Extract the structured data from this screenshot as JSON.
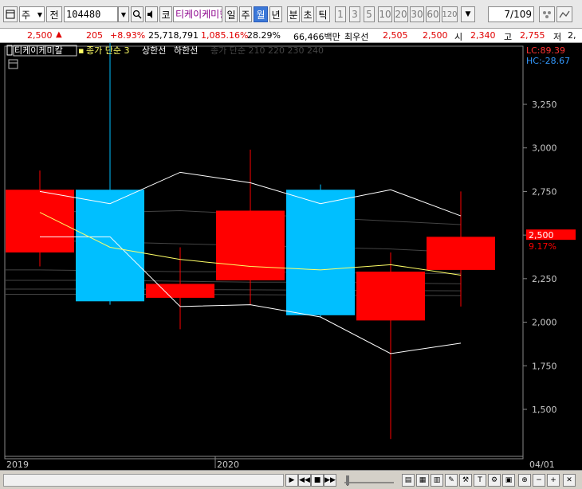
{
  "toolbar": {
    "period_type": "주",
    "prev_label": "전",
    "stock_code": "104480",
    "code_label": "코",
    "stock_name": "티케이케미칼",
    "timeframes": [
      "일",
      "주",
      "월",
      "년",
      "분",
      "초",
      "틱"
    ],
    "selected_timeframe": "월",
    "intervals": [
      "1",
      "3",
      "5",
      "10",
      "20",
      "30",
      "60",
      "120"
    ],
    "page_value": "7",
    "page_total": "/109"
  },
  "quote": {
    "price": "2,500",
    "change": "205",
    "change_pct": "+8.93%",
    "volume": "25,718,791",
    "volume_ratio": "1,085.16%",
    "turnover": "28.29%",
    "amount": "66,466백만",
    "bid_label": "최우선",
    "ask": "2,505",
    "bid": "2,500",
    "open_label": "시",
    "open": "2,340",
    "high_label": "고",
    "high": "2,755",
    "low_label": "저",
    "low": "2,"
  },
  "legend": {
    "name": "티케이케미칼",
    "ma": "종가 단순 3",
    "upper": "상한선",
    "lower": "하한선",
    "ma_grey": "종가 단순 210 220 230 240",
    "lc": "LC:89.39",
    "hc": "HC:-28.67"
  },
  "chart_data": {
    "type": "candlestick",
    "x_labels": [
      "2019",
      "2020",
      "04/01"
    ],
    "y_ticks": [
      1500,
      1750,
      2000,
      2250,
      2500,
      2750,
      3000,
      3250
    ],
    "y_range": [
      1250,
      3500
    ],
    "current_price": "2,500",
    "current_pct": "9.17%",
    "candles": [
      {
        "open": 2400,
        "close": 2760,
        "high": 2870,
        "low": 2320,
        "color": "red"
      },
      {
        "open": 2760,
        "close": 2120,
        "high": 3650,
        "low": 2100,
        "color": "cyan"
      },
      {
        "open": 2140,
        "close": 2220,
        "high": 2430,
        "low": 1960,
        "color": "red"
      },
      {
        "open": 2240,
        "close": 2640,
        "high": 2990,
        "low": 2100,
        "color": "red"
      },
      {
        "open": 2760,
        "close": 2040,
        "high": 2790,
        "low": 2030,
        "color": "cyan"
      },
      {
        "open": 2010,
        "close": 2290,
        "high": 2400,
        "low": 1330,
        "color": "red"
      },
      {
        "open": 2300,
        "close": 2490,
        "high": 2750,
        "low": 2090,
        "color": "red"
      }
    ],
    "ma3": [
      2630,
      2430,
      2360,
      2320,
      2300,
      2330,
      2270
    ],
    "upper_band": [
      2750,
      2680,
      2860,
      2800,
      2680,
      2760,
      2610
    ],
    "lower_band": [
      2490,
      2490,
      2090,
      2100,
      2030,
      1820,
      1880
    ]
  },
  "colors": {
    "up": "#ff0000",
    "down": "#00bfff",
    "ma": "#ffff66",
    "band": "#ffffff",
    "axis_text": "#c8c8c8"
  }
}
